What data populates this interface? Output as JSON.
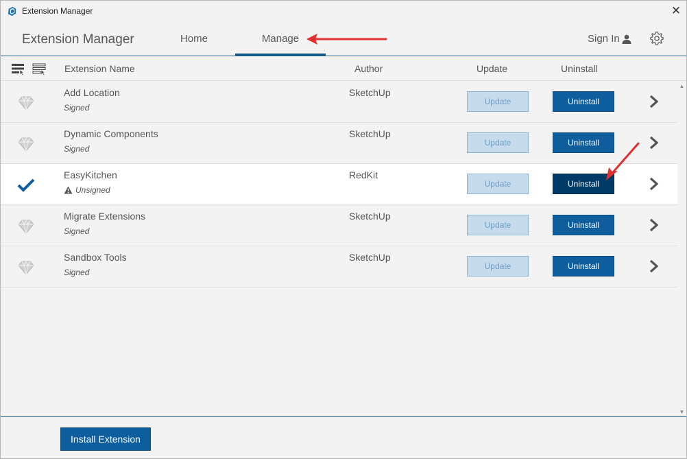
{
  "window": {
    "title": "Extension Manager",
    "close_glyph": "✕"
  },
  "header": {
    "brand": "Extension Manager",
    "tabs": [
      {
        "label": "Home",
        "active": false
      },
      {
        "label": "Manage",
        "active": true
      }
    ],
    "sign_in": "Sign In"
  },
  "columns": {
    "name": "Extension Name",
    "author": "Author",
    "update": "Update",
    "uninstall": "Uninstall"
  },
  "extensions": [
    {
      "name": "Add Location",
      "signature": "Signed",
      "author": "SketchUp",
      "status_icon": "gem-icon",
      "selected": false
    },
    {
      "name": "Dynamic Components",
      "signature": "Signed",
      "author": "SketchUp",
      "status_icon": "gem-icon",
      "selected": false
    },
    {
      "name": "EasyKitchen",
      "signature": "Unsigned",
      "author": "RedKit",
      "status_icon": "checkmark-icon",
      "selected": true
    },
    {
      "name": "Migrate Extensions",
      "signature": "Signed",
      "author": "SketchUp",
      "status_icon": "gem-icon",
      "selected": false
    },
    {
      "name": "Sandbox Tools",
      "signature": "Signed",
      "author": "SketchUp",
      "status_icon": "gem-icon",
      "selected": false
    }
  ],
  "buttons": {
    "update": "Update",
    "uninstall": "Uninstall",
    "install": "Install Extension"
  },
  "colors": {
    "accent": "#0e5e9e",
    "accent_dark": "#003a66",
    "update_disabled_bg": "#c6dced",
    "annotation_arrow": "#e03030"
  }
}
